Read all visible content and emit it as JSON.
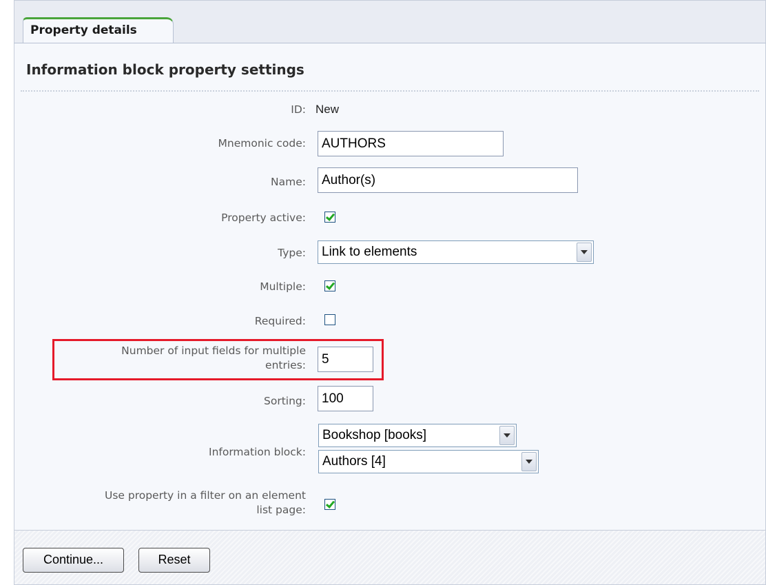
{
  "tab": {
    "label": "Property details"
  },
  "section": {
    "title": "Information block property settings"
  },
  "fields": {
    "id": {
      "label": "ID:",
      "value": "New"
    },
    "code": {
      "label": "Mnemonic code:",
      "value": "AUTHORS"
    },
    "name": {
      "label": "Name:",
      "value": "Author(s)"
    },
    "active": {
      "label": "Property active:",
      "checked": true
    },
    "type": {
      "label": "Type:",
      "value": "Link to elements"
    },
    "multiple": {
      "label": "Multiple:",
      "checked": true
    },
    "required": {
      "label": "Required:",
      "checked": false
    },
    "multi_count": {
      "label_line1": "Number of input fields for multiple",
      "label_line2": "entries:",
      "value": "5"
    },
    "sorting": {
      "label": "Sorting:",
      "value": "100"
    },
    "iblock": {
      "label": "Information block:",
      "type_value": "Bookshop [books]",
      "block_value": "Authors [4]"
    },
    "filter": {
      "label_line1": "Use property in a filter on an element",
      "label_line2": "list page:",
      "checked": true
    }
  },
  "buttons": {
    "continue": "Continue...",
    "reset": "Reset"
  },
  "colors": {
    "tab_accent": "#4aa43a",
    "highlight": "#e51a2a",
    "checkmark": "#22a822"
  }
}
